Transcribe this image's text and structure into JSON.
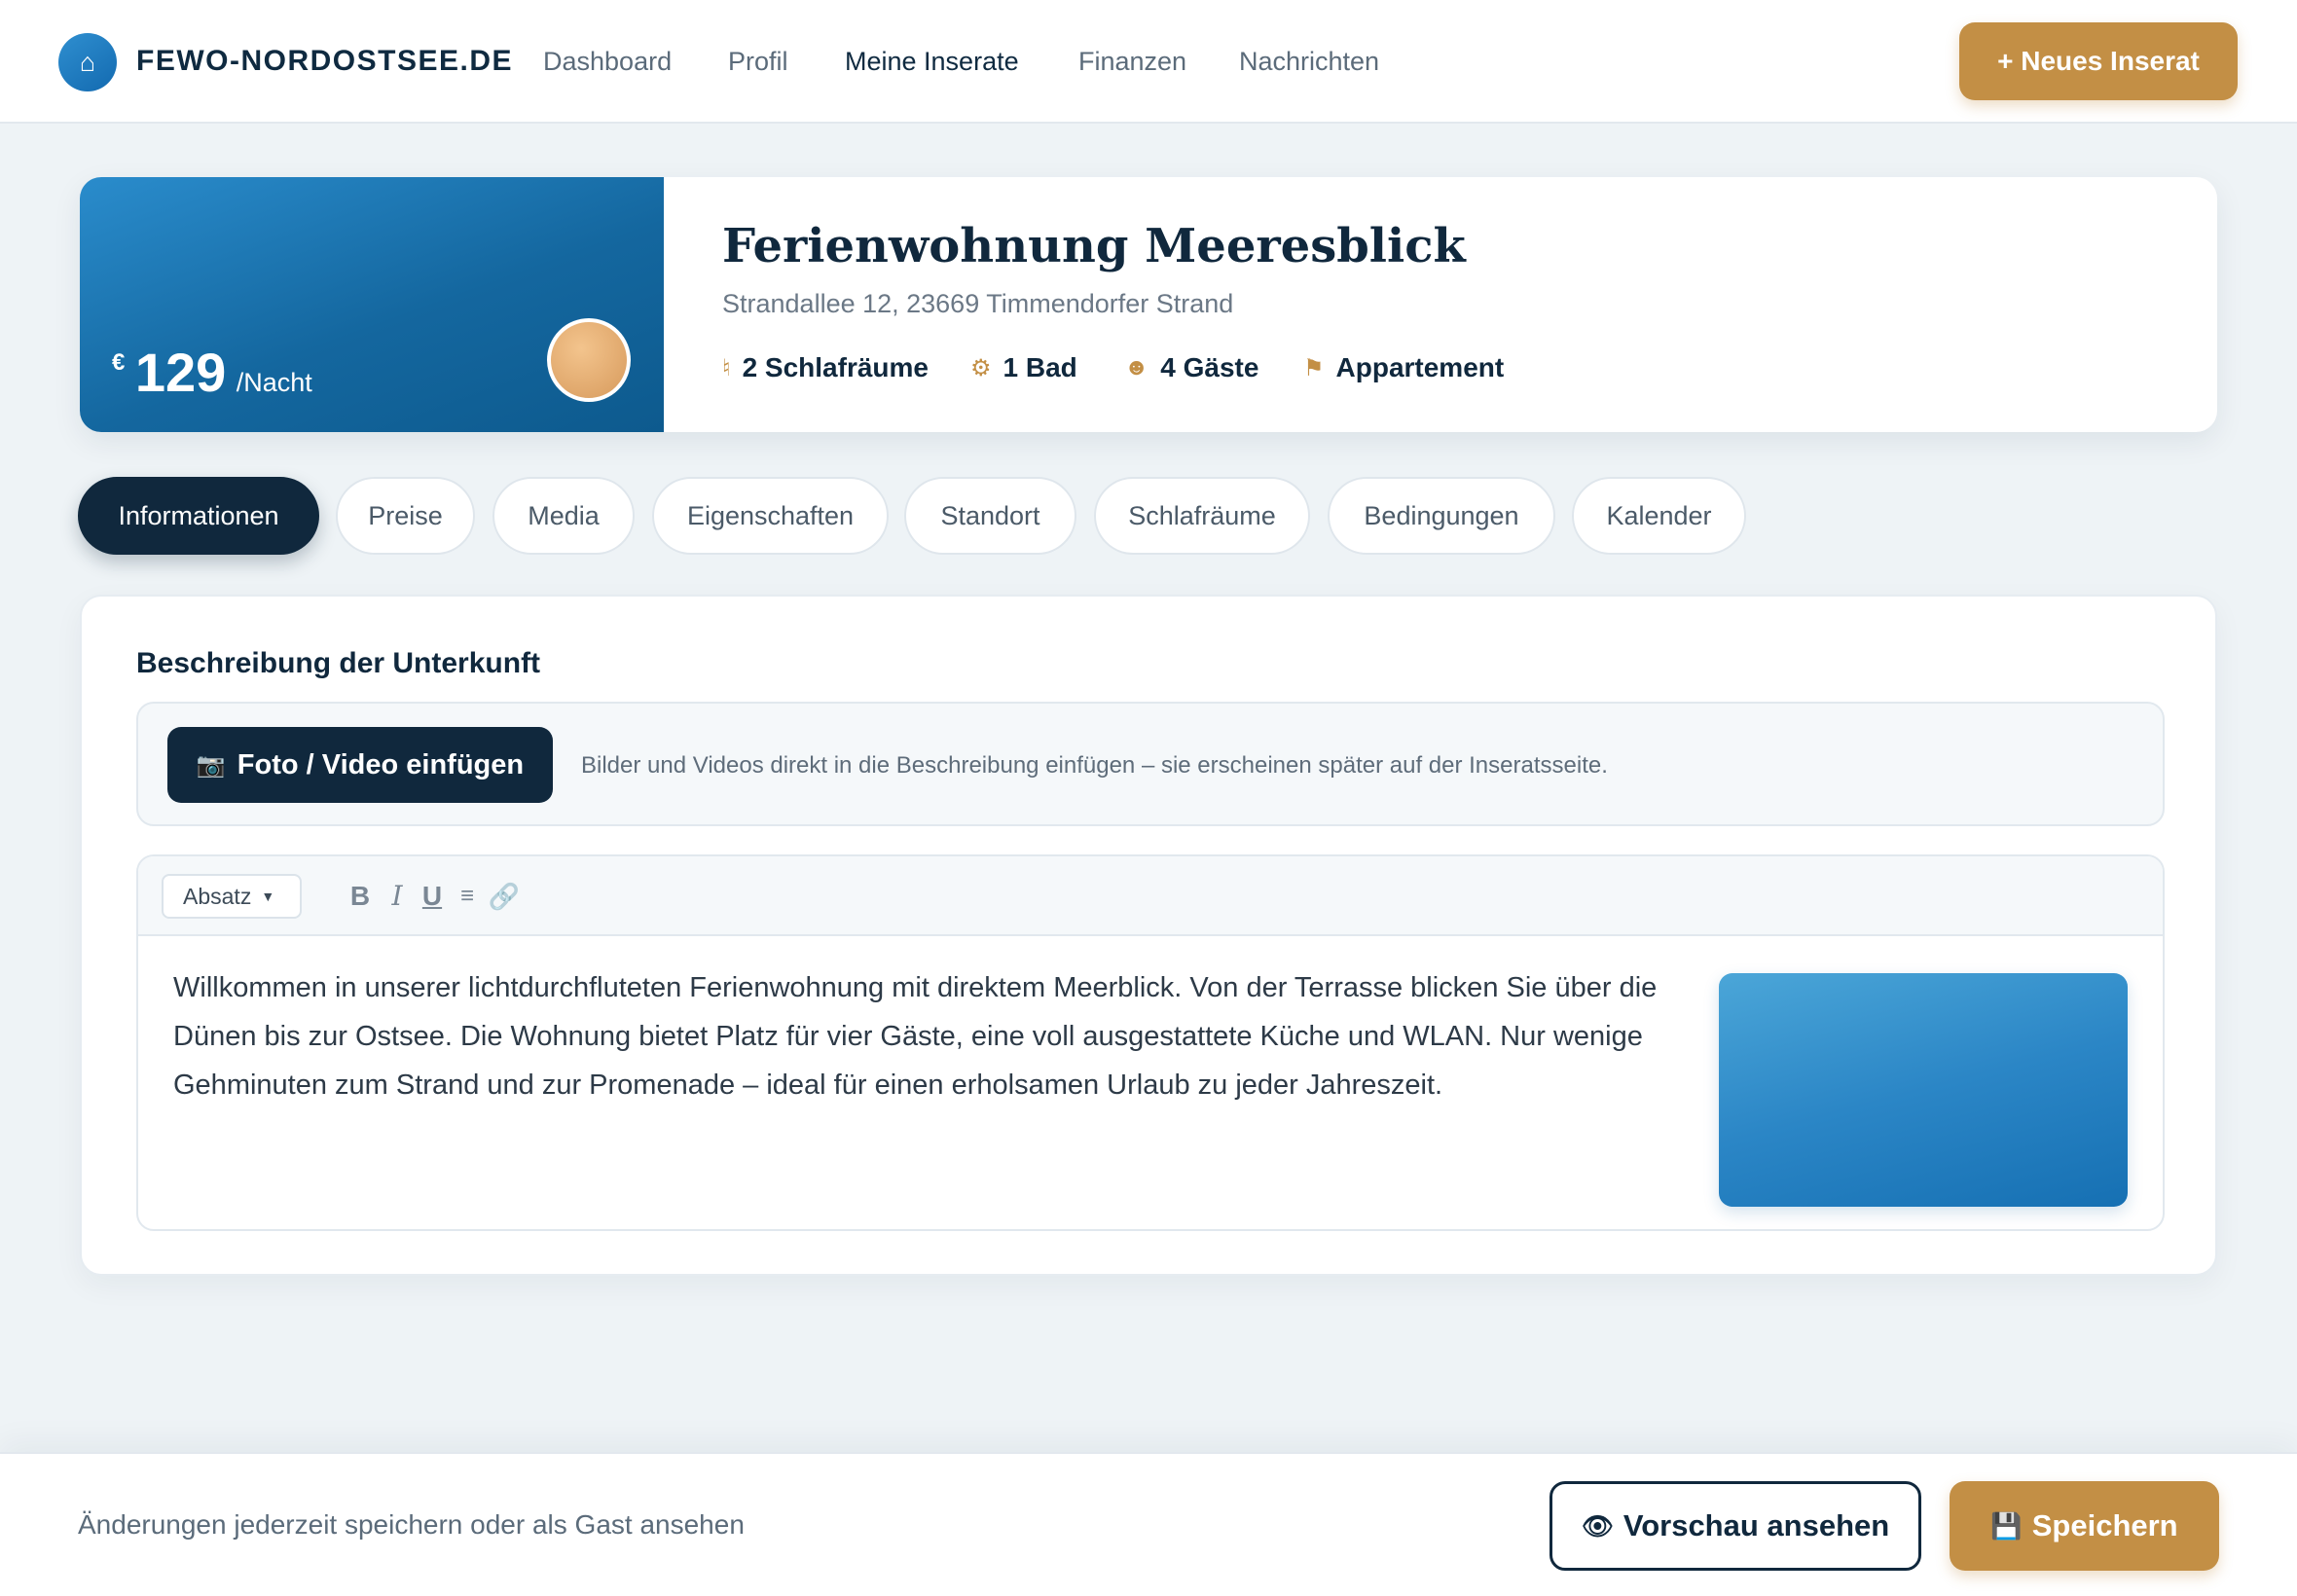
{
  "brand": {
    "icon": "home-icon",
    "glyph": "⌂",
    "name": "FEWO-NORDOSTSEE.DE"
  },
  "nav": {
    "items": [
      "Dashboard",
      "Profil",
      "Meine Inserate",
      "Finanzen",
      "Nachrichten"
    ],
    "active": "Meine Inserate",
    "new_listing": "+ Neues Inserat"
  },
  "listing": {
    "title": "Ferienwohnung Meeresblick",
    "address": "Strandallee 12, 23669 Timmendorfer Strand",
    "price": {
      "currency": "€",
      "amount": "129",
      "per": "/Nacht"
    },
    "features": [
      {
        "icon": "bed-icon",
        "glyph": "♮",
        "label": "2 Schlafräume"
      },
      {
        "icon": "gear-icon",
        "glyph": "⚙",
        "label": "1 Bad"
      },
      {
        "icon": "guests-icon",
        "glyph": "☻",
        "label": "4 Gäste"
      },
      {
        "icon": "flag-icon",
        "glyph": "⚑",
        "label": "Appartement"
      }
    ]
  },
  "tabs": [
    "Informationen",
    "Preise",
    "Media",
    "Eigenschaften",
    "Standort",
    "Schlafräume",
    "Bedingungen",
    "Kalender"
  ],
  "active_tab": "Informationen",
  "section": {
    "title": "Beschreibung der Unterkunft",
    "media_button": {
      "icon": "camera-icon",
      "glyph": "📷",
      "label": "Foto / Video einfügen"
    },
    "media_hint": "Bilder und Videos direkt in die Beschreibung einfügen – sie erscheinen später auf der Inseratsseite.",
    "toolbar": {
      "format_select": "Absatz",
      "bold": "B",
      "italic": "I",
      "underline": "U",
      "list": "≡",
      "link": "🔗"
    },
    "description": "Willkommen in unserer lichtdurchfluteten Ferienwohnung mit direktem Meerblick. Von der Terrasse blicken Sie über die Dünen bis zur Ostsee. Die Wohnung bietet Platz für vier Gäste, eine voll ausgestattete Küche und WLAN. Nur wenige Gehminuten zum Strand und zur Promenade – ideal für einen erholsamen Urlaub zu jeder Jahreszeit."
  },
  "footer": {
    "hint": "Änderungen jederzeit speichern oder als Gast ansehen",
    "preview": {
      "icon": "eye-icon",
      "glyph": "👁",
      "label": "Vorschau ansehen"
    },
    "save": {
      "icon": "floppy-disk-icon",
      "glyph": "💾",
      "label": "Speichern"
    }
  },
  "colors": {
    "primary_dark": "#10283d",
    "accent_gold": "#c38f45",
    "hero_blue": "#14679f",
    "background": "#eef3f6"
  }
}
